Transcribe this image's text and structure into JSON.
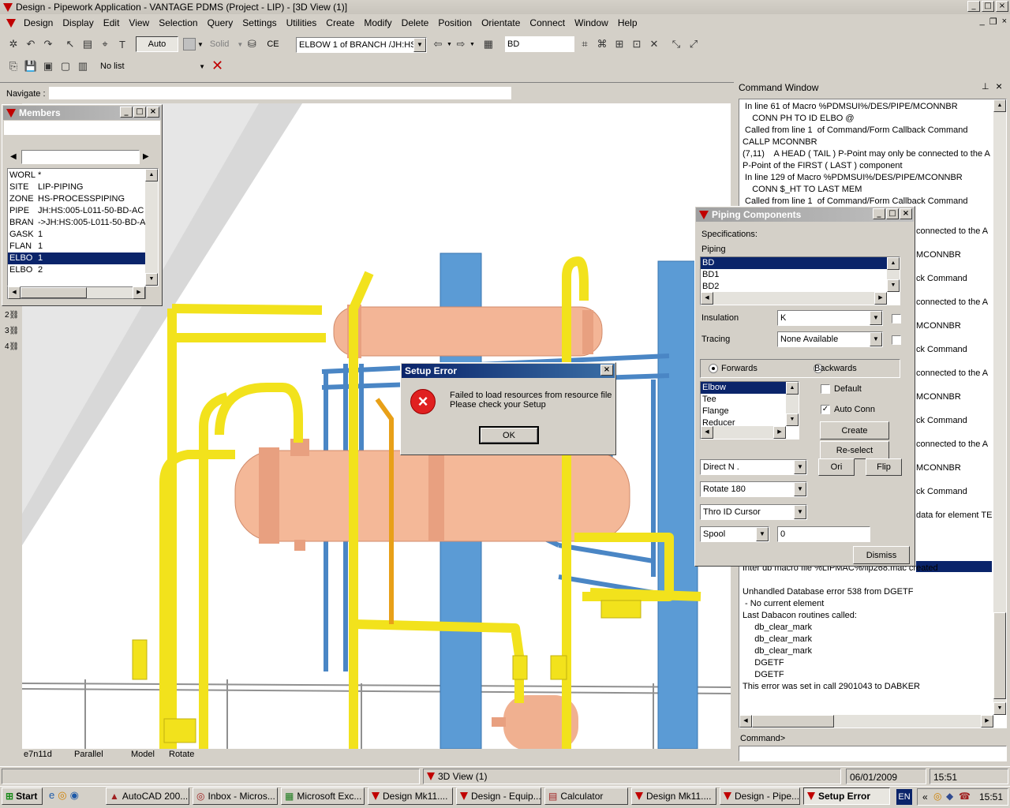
{
  "window": {
    "title": "Design - Pipework Application - VANTAGE PDMS (Project - LIP) - [3D View (1)]"
  },
  "menu": [
    "Design",
    "Display",
    "Edit",
    "View",
    "Selection",
    "Query",
    "Settings",
    "Utilities",
    "Create",
    "Modify",
    "Delete",
    "Position",
    "Orientate",
    "Connect",
    "Window",
    "Help"
  ],
  "toolbar": {
    "auto_label": "Auto",
    "solid_label": "Solid",
    "ce_label": "CE",
    "ce_value": "ELBOW 1 of BRANCH /JH:HS",
    "spec_value": "BD",
    "list_value": "No list"
  },
  "navigate": {
    "label": "Navigate :"
  },
  "members": {
    "title": "Members",
    "rows": [
      {
        "type": "WORL",
        "name": "*"
      },
      {
        "type": "SITE",
        "name": "LIP-PIPING"
      },
      {
        "type": "ZONE",
        "name": "HS-PROCESSPIPING"
      },
      {
        "type": "PIPE",
        "name": "JH:HS:005-L011-50-BD-AC"
      },
      {
        "type": "BRAN",
        "name": "->JH:HS:005-L011-50-BD-A"
      },
      {
        "type": "GASK",
        "name": "1"
      },
      {
        "type": "FLAN",
        "name": "1"
      },
      {
        "type": "ELBO",
        "name": "1",
        "selected": true
      },
      {
        "type": "ELBO",
        "name": "2"
      }
    ]
  },
  "viewport": {
    "status": [
      "e7n11d",
      "Parallel",
      "Model",
      "Rotate"
    ],
    "colors": {
      "pipe": "#f2e21c",
      "steel": "#5b9bd5",
      "vessel": "#f0b090"
    }
  },
  "setup_error": {
    "title": "Setup Error",
    "message_line1": "Failed to load resources from resource file",
    "message_line2": "Please check your Setup",
    "ok_label": "OK"
  },
  "command_window": {
    "title": "Command Window",
    "lines": [
      " In line 61 of Macro %PDMSUI%/DES/PIPE/MCONNBR",
      "    CONN PH TO ID ELBO @",
      " Called from line 1  of Command/Form Callback Command",
      "CALLP MCONNBR",
      "(7,11)    A HEAD ( TAIL ) P-Point may only be connected to the A",
      "P-Point of the FIRST ( LAST ) component",
      " In line 129 of Macro %PDMSUI%/DES/PIPE/MCONNBR",
      "    CONN $_HT TO LAST MEM",
      " Called from line 1  of Command/Form Callback Command"
    ],
    "right_fragments": [
      {
        "text": "connected to the A"
      },
      {
        "text": "MCONNBR"
      },
      {
        "text": "ck Command"
      },
      {
        "text": "connected to the A"
      },
      {
        "text": "MCONNBR"
      },
      {
        "text": "ck Command"
      },
      {
        "text": "connected to the A"
      },
      {
        "text": "MCONNBR"
      },
      {
        "text": "ck Command"
      },
      {
        "text": "connected to the A"
      },
      {
        "text": "MCONNBR"
      },
      {
        "text": "ck Command"
      },
      {
        "text": "data for element TEE"
      }
    ],
    "bottom_lines": [
      "Inter db macro file %LIPMAC%/lip268.mac created",
      "",
      "Unhandled Database error 538 from DGETF",
      " - No current element",
      "Last Dabacon routines called:",
      "     db_clear_mark",
      "     db_clear_mark",
      "     db_clear_mark",
      "     DGETF",
      "     DGETF",
      "This error was set in call 2901043 to DABKER"
    ],
    "command_label": "Command>"
  },
  "piping_components": {
    "title": "Piping Components",
    "specifications_label": "Specifications:",
    "piping_label": "Piping",
    "specs": [
      "BD",
      "BD1",
      "BD2"
    ],
    "insulation_label": "Insulation",
    "insulation_value": "K",
    "tracing_label": "Tracing",
    "tracing_value": "None Available",
    "forwards_label": "Forwards",
    "backwards_label": "Backwards",
    "types": [
      "Elbow",
      "Tee",
      "Flange",
      "Reducer"
    ],
    "default_label": "Default",
    "auto_conn_label": "Auto Conn",
    "create_label": "Create",
    "reselect_label": "Re-select",
    "direction_value": "Direct N   .",
    "ori_label": "Ori",
    "flip_label": "Flip",
    "rotate_value": "Rotate 180",
    "thro_value": "Thro ID Cursor",
    "spool_value": "Spool",
    "spool_number": "0",
    "dismiss_label": "Dismiss"
  },
  "statusbar": {
    "view_tab": "3D View (1)",
    "date": "06/01/2009",
    "time": "15:51"
  },
  "taskbar": {
    "start": "Start",
    "items": [
      "AutoCAD 200...",
      "Inbox - Micros...",
      "Microsoft Exc...",
      "Design Mk11....",
      "Design - Equip...",
      "Calculator",
      "Design Mk11....",
      "Design - Pipe...",
      "Setup Error"
    ],
    "lang": "EN",
    "clock": "15:51"
  }
}
